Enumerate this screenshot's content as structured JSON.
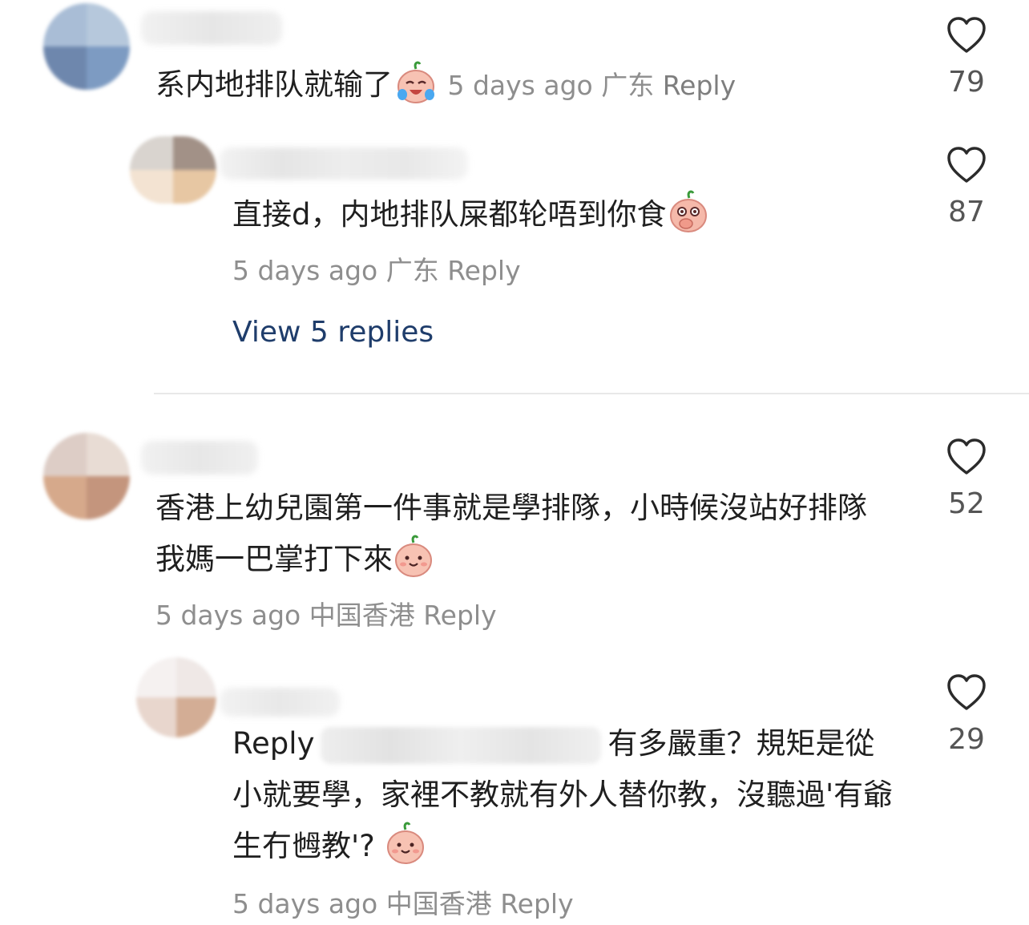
{
  "comments": [
    {
      "text": "系内地排队就输了",
      "emoji": "crying-laughing-peach-emoji",
      "time": "5 days ago",
      "location": "广东",
      "reply_label": "Reply",
      "likes": "79"
    },
    {
      "text": "直接d，内地排队屎都轮唔到你食",
      "emoji": "shocked-peach-emoji",
      "time": "5 days ago",
      "location": "广东",
      "reply_label": "Reply",
      "likes": "87",
      "view_replies": "View 5 replies"
    },
    {
      "text": "香港上幼兒園第一件事就是學排隊，小時候沒站好排隊我媽一巴掌打下來",
      "emoji": "smiling-peach-emoji",
      "time": "5 days ago",
      "location": "中国香港",
      "reply_label": "Reply",
      "likes": "52"
    },
    {
      "prefix": "Reply",
      "text": "有多嚴重？規矩是從小就要學，家裡不教就有外人替你教，沒聽過'有爺生冇乸教'?",
      "emoji": "smiling-peach-emoji",
      "time": "5 days ago",
      "location": "中国香港",
      "reply_label": "Reply",
      "likes": "29"
    }
  ],
  "icons": {
    "like": "heart-outline-icon"
  },
  "colors": {
    "link": "#1f3d6b",
    "meta": "#8e8e8e",
    "text": "#1f1f1f"
  }
}
